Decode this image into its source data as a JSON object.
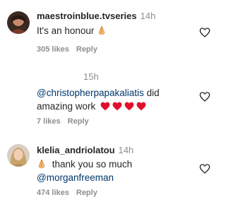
{
  "comments": [
    {
      "username": "maestroinblue.tvseries",
      "time": "14h",
      "text": "It's an honour",
      "likes": "305 likes",
      "reply": "Reply"
    },
    {
      "username": "",
      "time": "15h",
      "mention": "@christopherpapakaliatis",
      "text_after_mention": "did",
      "text_line2": "amazing work",
      "likes": "7 likes",
      "reply": "Reply"
    },
    {
      "username": "klelia_andriolatou",
      "time": "14h",
      "text": "thank you so much",
      "mention": "@morganfreeman",
      "likes": "474 likes",
      "reply": "Reply"
    }
  ],
  "icons": {
    "like": "heart-outline-icon",
    "pray": "folded-hands-emoji",
    "red_heart": "red-heart-emoji"
  },
  "colors": {
    "text": "#262626",
    "muted": "#8e8e8e",
    "mention": "#00376b",
    "heart": "#e0102b"
  }
}
